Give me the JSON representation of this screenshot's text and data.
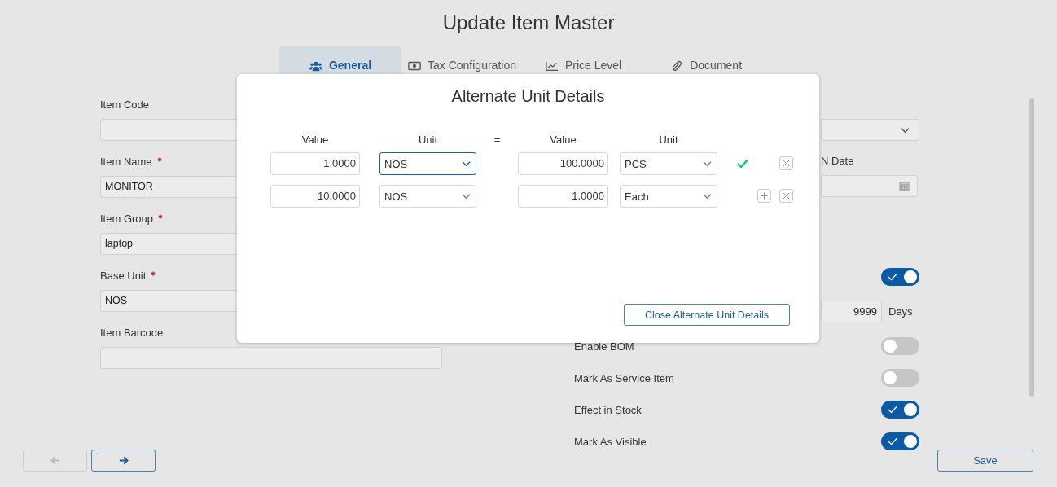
{
  "page": {
    "title": "Update Item Master"
  },
  "tabs": [
    {
      "label": "General",
      "selected": true
    },
    {
      "label": "Tax Configuration",
      "selected": false
    },
    {
      "label": "Price Level",
      "selected": false
    },
    {
      "label": "Document",
      "selected": false
    }
  ],
  "left_fields": [
    {
      "label": "Item Code",
      "required": false
    },
    {
      "label": "Item Name",
      "required": true,
      "value": "MONITOR"
    },
    {
      "label": "Item Group",
      "required": true,
      "value": "laptop"
    },
    {
      "label": "Base Unit",
      "required": true,
      "value": "NOS"
    },
    {
      "label": "Item Barcode",
      "required": false
    }
  ],
  "right_fields": [
    {
      "kind": "select"
    },
    {
      "kind": "date",
      "label": "N Date"
    },
    {
      "kind": "toggle",
      "on": true
    },
    {
      "kind": "number",
      "value": "9999",
      "suffix": "Days"
    },
    {
      "kind": "toggle",
      "label": "Enable BOM",
      "on": false
    },
    {
      "kind": "toggle",
      "label": "Mark As Service Item",
      "on": false
    },
    {
      "kind": "toggle",
      "label": "Effect in Stock",
      "on": true
    },
    {
      "kind": "toggle",
      "label": "Mark As Visible",
      "on": true
    }
  ],
  "modal": {
    "title": "Alternate Unit Details",
    "headers": [
      "Value",
      "Unit",
      "=",
      "Value",
      "Unit"
    ],
    "rows": [
      {
        "value": "1.0000",
        "unit": "NOS",
        "unit_focused": true,
        "alt_value": "100.0000",
        "alt_unit": "PCS",
        "saved": true
      },
      {
        "value": "10.0000",
        "unit": "NOS",
        "unit_focused": false,
        "alt_value": "1.0000",
        "alt_unit": "Each",
        "saved": false
      }
    ],
    "close_button": "Close Alternate Unit Details"
  },
  "footer": {
    "back_disabled": true,
    "save_button": "Save"
  }
}
